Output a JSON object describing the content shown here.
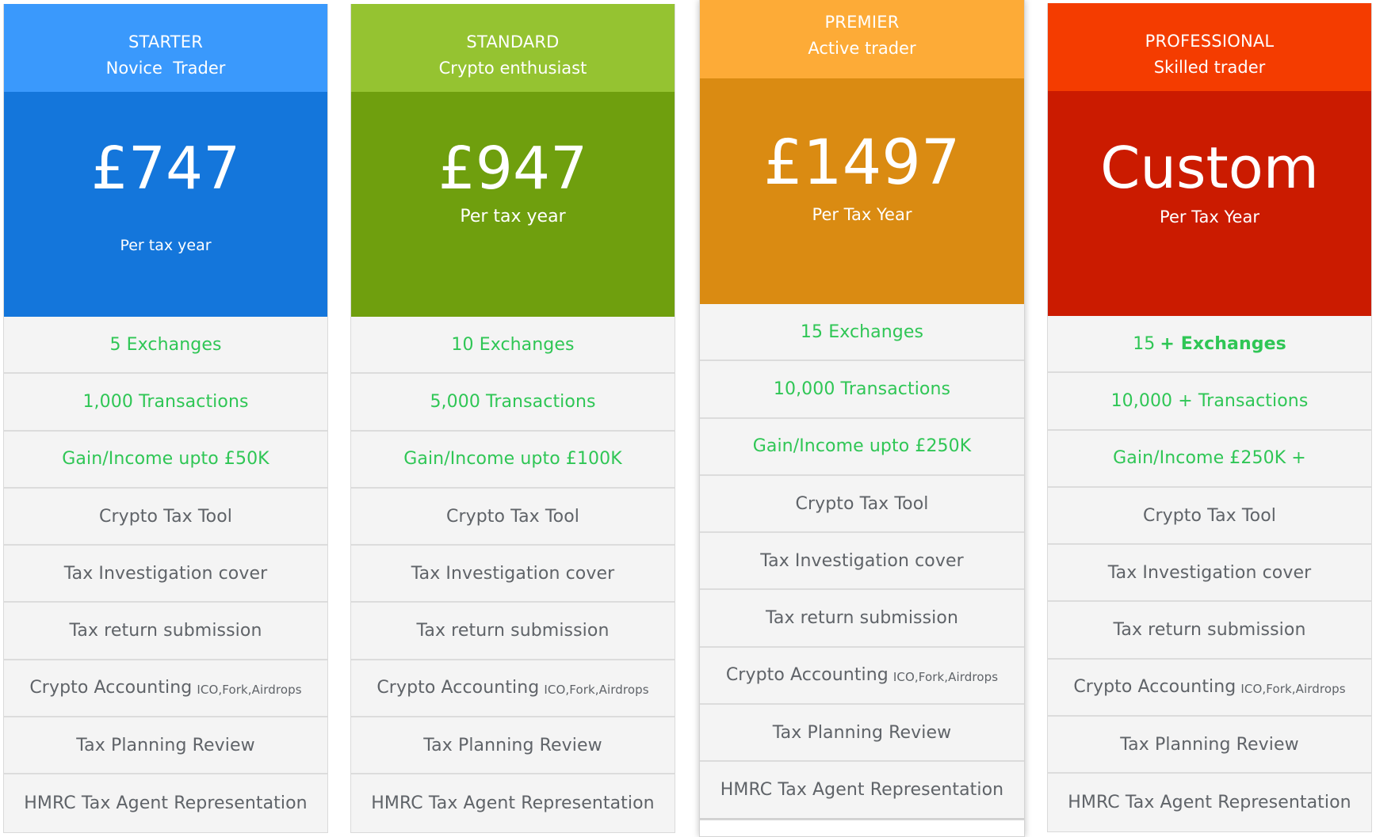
{
  "plans": [
    {
      "id": "starter",
      "tier": "STARTER",
      "subtitle": "Novice  Trader",
      "price": "£747",
      "period": "Per tax year",
      "header_color": "#3a99fc",
      "price_color": "#1476db",
      "features": [
        {
          "text": "5 Exchanges",
          "highlight": true
        },
        {
          "text": "1,000 Transactions",
          "highlight": true
        },
        {
          "text": "Gain/Income upto £50K",
          "highlight": true
        },
        {
          "text": "Crypto Tax Tool"
        },
        {
          "text": "Tax Investigation cover"
        },
        {
          "text": "Tax return submission"
        },
        {
          "text": "Crypto Accounting",
          "note": "ICO,Fork,Airdrops"
        },
        {
          "text": "Tax Planning Review"
        },
        {
          "text": "HMRC Tax Agent Representation"
        }
      ]
    },
    {
      "id": "standard",
      "tier": "STANDARD",
      "subtitle": "Crypto enthusiast",
      "price": "£947",
      "period": "Per tax year",
      "header_color": "#95c331",
      "price_color": "#6f9f0e",
      "features": [
        {
          "text": "10 Exchanges",
          "highlight": true
        },
        {
          "text": "5,000 Transactions",
          "highlight": true
        },
        {
          "text": "Gain/Income upto £100K",
          "highlight": true
        },
        {
          "text": "Crypto Tax Tool"
        },
        {
          "text": "Tax Investigation cover"
        },
        {
          "text": "Tax return submission"
        },
        {
          "text": "Crypto Accounting",
          "note": "ICO,Fork,Airdrops"
        },
        {
          "text": "Tax Planning Review"
        },
        {
          "text": "HMRC Tax Agent Representation"
        }
      ]
    },
    {
      "id": "premier",
      "tier": "PREMIER",
      "subtitle": "Active trader",
      "price": "£1497",
      "period": "Per Tax Year",
      "header_color": "#fdab37",
      "price_color": "#da8b12",
      "features": [
        {
          "text": "15 Exchanges",
          "highlight": true
        },
        {
          "text": "10,000 Transactions",
          "highlight": true
        },
        {
          "text": "Gain/Income upto £250K",
          "highlight": true
        },
        {
          "text": "Crypto Tax Tool"
        },
        {
          "text": "Tax Investigation cover"
        },
        {
          "text": "Tax return submission"
        },
        {
          "text": "Crypto Accounting",
          "note": "ICO,Fork,Airdrops"
        },
        {
          "text": "Tax Planning Review"
        },
        {
          "text": "HMRC Tax Agent Representation"
        }
      ]
    },
    {
      "id": "professional",
      "tier": "PROFESSIONAL",
      "subtitle": "Skilled trader",
      "price": "Custom",
      "period": "Per Tax Year",
      "header_color": "#f43c00",
      "price_color": "#cb1b00",
      "features": [
        {
          "text": "15",
          "bold_suffix": "+ Exchanges",
          "highlight": true
        },
        {
          "text": "10,000 + Transactions",
          "highlight": true
        },
        {
          "text": "Gain/Income £250K +",
          "highlight": true
        },
        {
          "text": "Crypto Tax Tool"
        },
        {
          "text": "Tax Investigation cover"
        },
        {
          "text": "Tax return submission"
        },
        {
          "text": "Crypto Accounting",
          "note": "ICO,Fork,Airdrops"
        },
        {
          "text": "Tax Planning Review"
        },
        {
          "text": "HMRC Tax Agent Representation"
        }
      ]
    }
  ],
  "colors": {
    "highlight_text": "#2fc655",
    "feature_text": "#5f6368",
    "row_background": "#f4f4f4"
  }
}
